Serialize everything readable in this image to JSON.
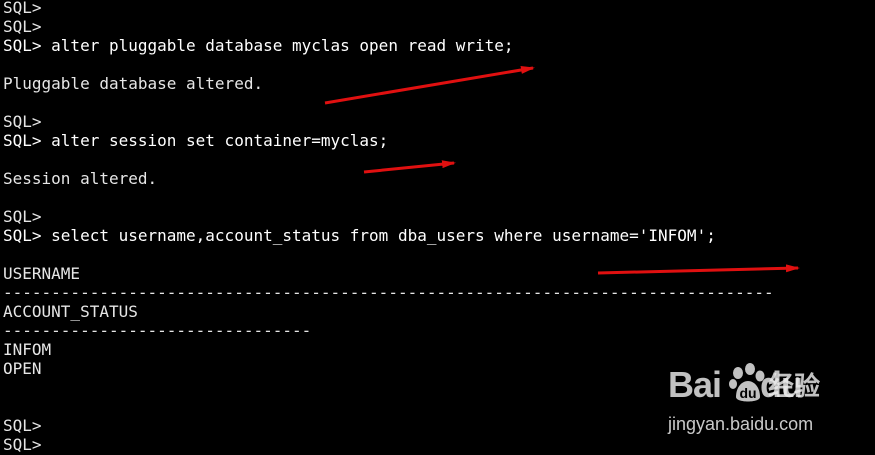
{
  "terminal": {
    "background": "#000000",
    "text_color": "#e6e6e6",
    "lines": [
      "SQL>",
      "SQL>",
      "SQL> alter pluggable database myclas open read write;",
      "",
      "Pluggable database altered.",
      "",
      "SQL>",
      "SQL> alter session set container=myclas;",
      "",
      "Session altered.",
      "",
      "SQL>",
      "SQL> select username,account_status from dba_users where username='INFOM';",
      "",
      "USERNAME",
      "--------------------------------------------------------------------------------",
      "ACCOUNT_STATUS",
      "--------------------------------",
      "INFOM",
      "OPEN",
      "",
      "",
      "SQL>",
      "SQL>"
    ]
  },
  "annotations": {
    "arrow_color": "#e01010"
  },
  "watermark": {
    "logo": "Bai  du",
    "label": "经验",
    "url": "jingyan.baidu.com"
  }
}
